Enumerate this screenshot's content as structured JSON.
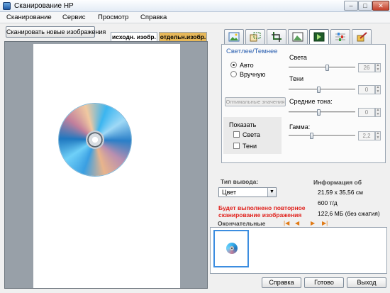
{
  "window": {
    "title": "Сканирование HP"
  },
  "menu": {
    "items": [
      "Сканирование",
      "Сервис",
      "Просмотр",
      "Справка"
    ]
  },
  "toolbar": {
    "scan_new_label": "Сканировать новые изображения"
  },
  "preview": {
    "tabs": [
      "исходн. изобр.",
      "отдельн.изобр."
    ],
    "active_tab": "исходн. изобр."
  },
  "tool_tabs": {
    "icons": [
      "image-icon",
      "resize-icon",
      "crop-icon",
      "enhance-icon",
      "exposure-icon",
      "color-icon",
      "sharpen-icon"
    ],
    "selected": 4
  },
  "adjust": {
    "title": "Светлее/Темнее",
    "mode": {
      "auto_label": "Авто",
      "manual_label": "Вручную",
      "selected": "auto"
    },
    "optimal_label": "Оптимальные значения",
    "show": {
      "label": "Показать",
      "highlights_label": "Света",
      "shadows_label": "Тени"
    },
    "sliders": [
      {
        "label": "Света",
        "value": "26"
      },
      {
        "label": "Тени",
        "value": "0"
      },
      {
        "label": "Средние тона:",
        "value": "0"
      },
      {
        "label": "Гамма:",
        "value": "2,2"
      }
    ]
  },
  "output": {
    "label": "Тип вывода:",
    "selected": "Цвет"
  },
  "info": {
    "label": "Информация об",
    "lines": [
      "21,59 x 35,56 см",
      "600 т/д",
      "122,6 МБ (без сжатия)"
    ]
  },
  "warning": {
    "lines": [
      "Будет выполнено повторное",
      "сканирование изображения"
    ]
  },
  "final": {
    "label": "Окончательные"
  },
  "buttons": {
    "help": "Справка",
    "done": "Готово",
    "exit": "Выход"
  }
}
